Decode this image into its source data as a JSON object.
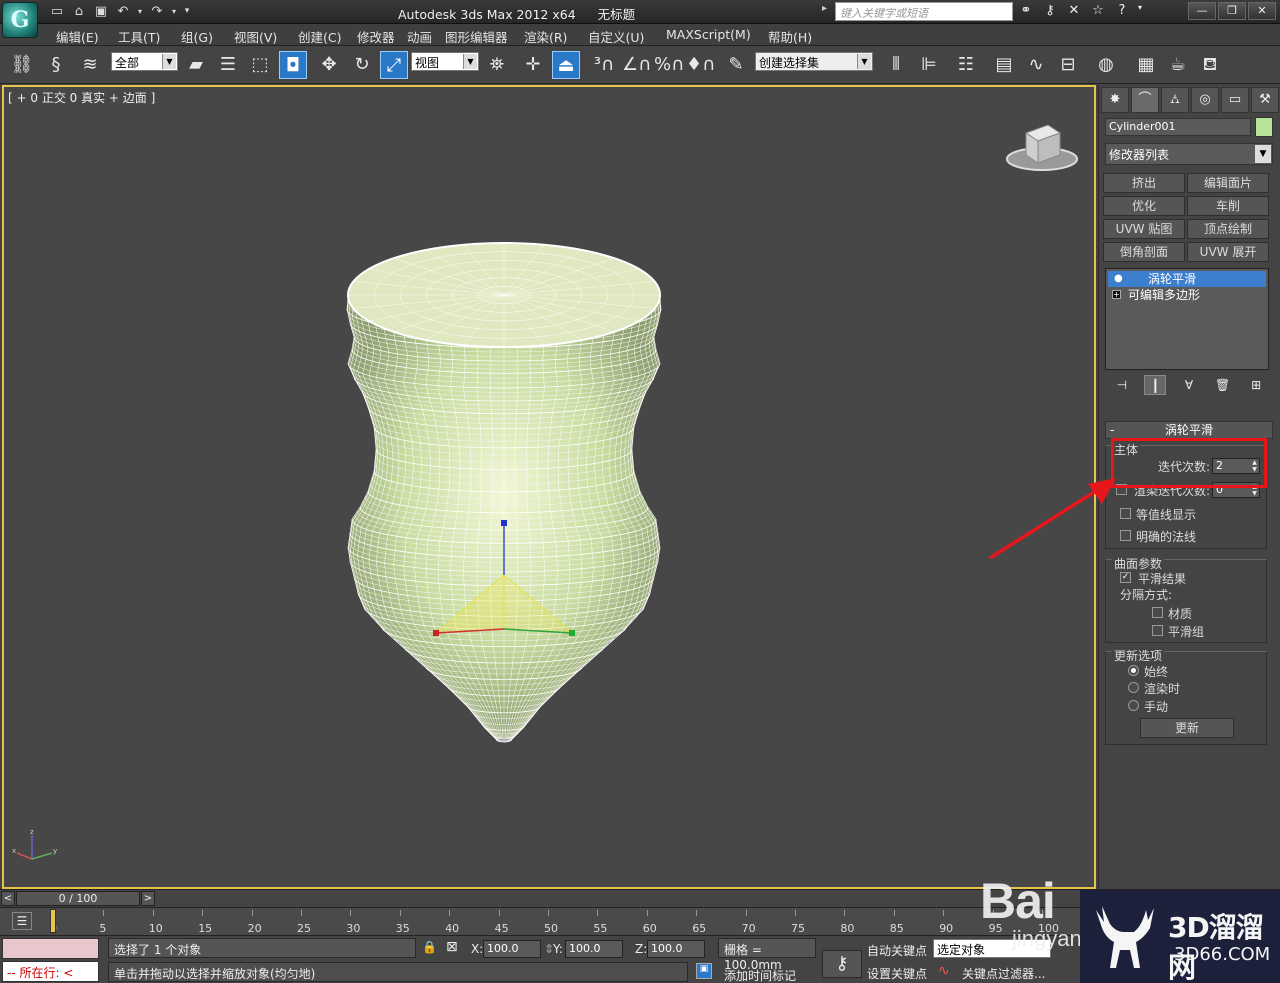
{
  "window": {
    "title": "Autodesk 3ds Max  2012 x64",
    "document": "无标题",
    "search_placeholder": "键入关键字或短语"
  },
  "menu": [
    "编辑(E)",
    "工具(T)",
    "组(G)",
    "视图(V)",
    "创建(C)",
    "修改器",
    "动画",
    "图形编辑器",
    "渲染(R)",
    "自定义(U)",
    "MAXScript(M)",
    "帮助(H)"
  ],
  "toolbar": {
    "selection_filter": "全部",
    "ref_coord": "视图",
    "named_selection": "创建选择集"
  },
  "viewport": {
    "label": "[ + 0 正交 0 真实 + 边面 ]",
    "highlight_color": "#e6c44a",
    "mesh_color": "#c8dca0"
  },
  "panel": {
    "object_name": "Cylinder001",
    "object_color": "#b6e39c",
    "modifier_list": "修改器列表",
    "modifier_buttons": [
      "挤出",
      "编辑面片",
      "优化",
      "车削",
      "UVW 贴图",
      "顶点绘制",
      "倒角剖面",
      "UVW 展开"
    ],
    "stack": [
      "涡轮平滑",
      "可编辑多边形"
    ],
    "rollout_title": "涡轮平滑",
    "main_group": "主体",
    "iterations_label": "迭代次数:",
    "iterations_value": "2",
    "render_iters_label": "渲染迭代次数:",
    "render_iters_value": "0",
    "isoline": "等值线显示",
    "explicit_normals": "明确的法线",
    "surface_group": "曲面参数",
    "smooth_result": "平滑结果",
    "separate_by": "分隔方式:",
    "materials": "材质",
    "smoothing_groups": "平滑组",
    "update_group": "更新选项",
    "always": "始终",
    "when_rendering": "渲染时",
    "manually": "手动",
    "update_button": "更新",
    "annotation_color": "#e8161b"
  },
  "timeline": {
    "frame": "0 / 100",
    "ticks": [
      "0",
      "5",
      "10",
      "15",
      "20",
      "25",
      "30",
      "35",
      "40",
      "45",
      "50",
      "55",
      "60",
      "65",
      "70",
      "75",
      "80",
      "85",
      "90",
      "95",
      "100"
    ]
  },
  "status": {
    "running": "所在行:",
    "selected": "选择了 1 个对象",
    "hint": "单击并拖动以选择并缩放对象(均匀地)",
    "x_label": "X:",
    "x": "100.0",
    "y_label": "Y:",
    "y": "100.0",
    "z_label": "Z:",
    "z": "100.0",
    "grid": "栅格 = 100.0mm",
    "add_time_tag": "添加时间标记",
    "auto_key": "自动关键点",
    "selected_objects": "选定对象",
    "set_key": "设置关键点",
    "key_filters": "关键点过滤器..."
  },
  "watermark": {
    "baidu": "Bai",
    "jingyan": "jingyan",
    "brand": "3D溜溜网",
    "site": "3D66.COM"
  }
}
